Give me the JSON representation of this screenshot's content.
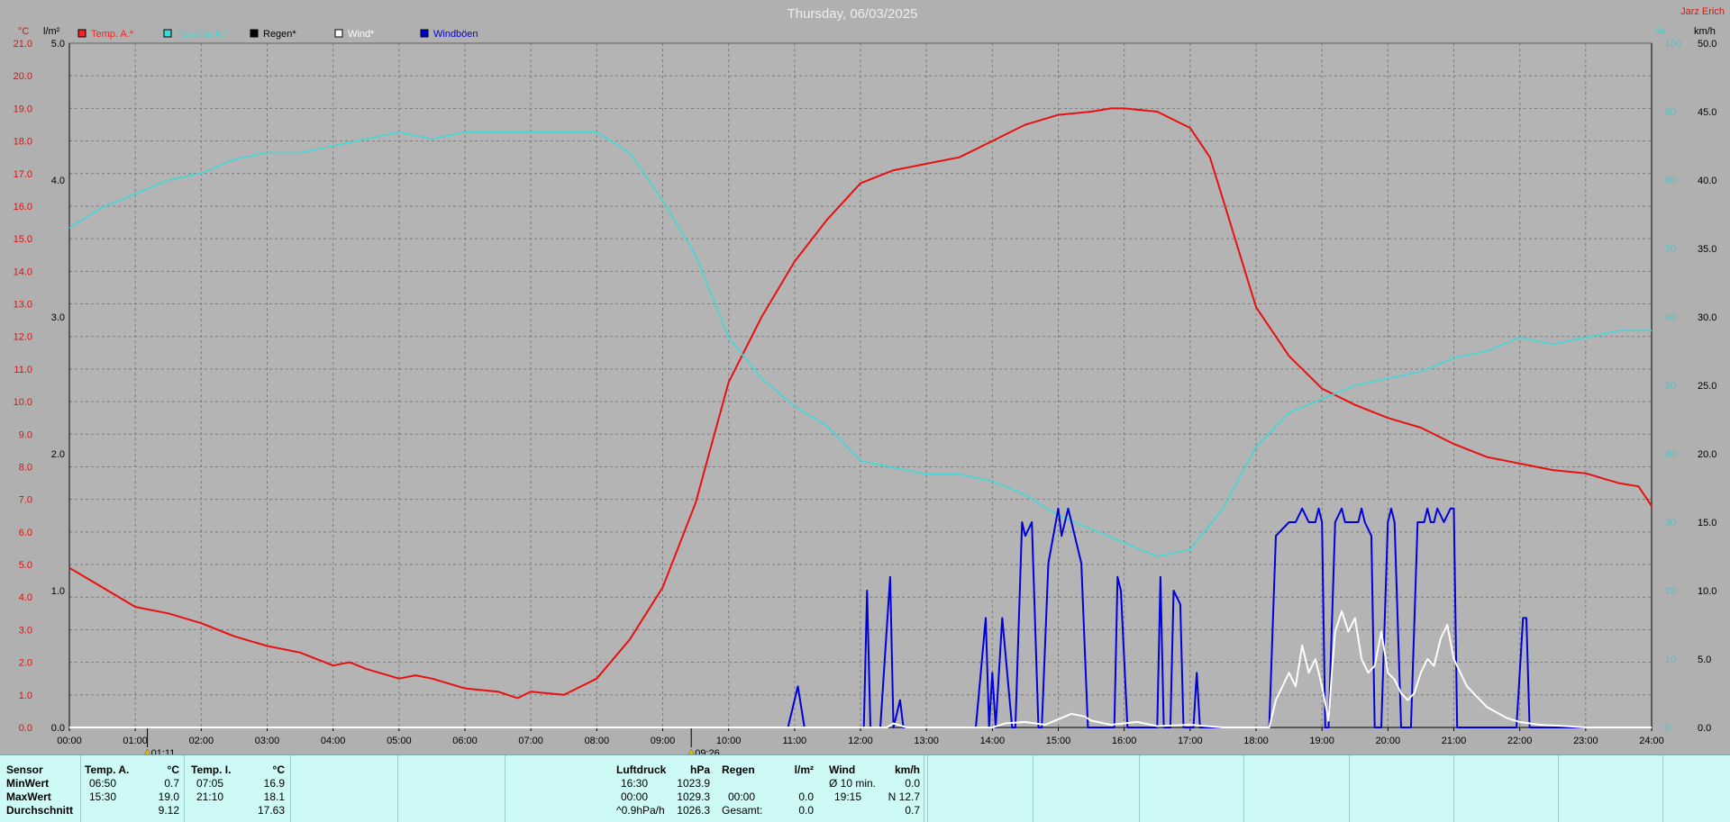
{
  "chart_data": {
    "type": "line",
    "title": "Thursday, 06/03/2025",
    "top_right_label": "Jarz Erich",
    "x_ticks": [
      "00:00",
      "01:00",
      "02:00",
      "03:00",
      "04:00",
      "05:00",
      "06:00",
      "07:00",
      "08:00",
      "09:00",
      "10:00",
      "11:00",
      "12:00",
      "13:00",
      "14:00",
      "15:00",
      "16:00",
      "17:00",
      "18:00",
      "19:00",
      "20:00",
      "21:00",
      "22:00",
      "23:00",
      "24:00"
    ],
    "x_range_hours": [
      0,
      24
    ],
    "y_left_temp": {
      "unit": "°C",
      "range": [
        0,
        21
      ],
      "ticks": [
        "0.0",
        "1.0",
        "2.0",
        "3.0",
        "4.0",
        "5.0",
        "6.0",
        "7.0",
        "8.0",
        "9.0",
        "10.0",
        "11.0",
        "12.0",
        "13.0",
        "14.0",
        "15.0",
        "16.0",
        "17.0",
        "18.0",
        "19.0",
        "20.0",
        "21.0"
      ]
    },
    "y_left_rain": {
      "unit": "l/m²",
      "range": [
        0,
        5
      ],
      "ticks": [
        "0.0",
        "1.0",
        "2.0",
        "3.0",
        "4.0",
        "5.0"
      ]
    },
    "y_right_humidity": {
      "unit": "%",
      "range": [
        0,
        100
      ],
      "ticks": [
        "0",
        "10",
        "20",
        "30",
        "40",
        "50",
        "60",
        "70",
        "80",
        "90",
        "100"
      ]
    },
    "y_right_wind": {
      "unit": "km/h",
      "range": [
        0,
        50
      ],
      "ticks": [
        "0.0",
        "5.0",
        "10.0",
        "15.0",
        "20.0",
        "25.0",
        "30.0",
        "35.0",
        "40.0",
        "45.0",
        "50.0"
      ]
    },
    "legend": [
      {
        "label": "Temp. A.*",
        "color": "#ff2020"
      },
      {
        "label": "Feuchte A.*",
        "color": "#40d8d8"
      },
      {
        "label": "Regen*",
        "color": "#000000"
      },
      {
        "label": "Wind*",
        "color": "#ffffff"
      },
      {
        "label": "Windböen",
        "color": "#0000dd"
      }
    ],
    "markers": [
      "01:11",
      "09:26"
    ],
    "grid": true,
    "series": [
      {
        "name": "Temp. A.*",
        "axis": "temp",
        "color": "#e81010",
        "x": [
          0,
          0.25,
          0.5,
          1,
          1.5,
          2,
          2.5,
          3,
          3.5,
          4,
          4.25,
          4.5,
          5,
          5.25,
          5.5,
          6,
          6.5,
          6.8,
          7,
          7.5,
          8,
          8.5,
          9,
          9.5,
          10,
          10.5,
          11,
          11.5,
          12,
          12.5,
          13,
          13.5,
          14,
          14.5,
          15,
          15.5,
          15.8,
          16,
          16.5,
          17,
          17.3,
          17.5,
          18,
          18.5,
          19,
          19.5,
          20,
          20.5,
          21,
          21.5,
          22,
          22.5,
          23,
          23.5,
          23.8,
          24
        ],
        "y": [
          4.9,
          4.6,
          4.3,
          3.7,
          3.5,
          3.2,
          2.8,
          2.5,
          2.3,
          1.9,
          2.0,
          1.8,
          1.5,
          1.6,
          1.5,
          1.2,
          1.1,
          0.9,
          1.1,
          1.0,
          1.5,
          2.7,
          4.3,
          6.9,
          10.6,
          12.6,
          14.3,
          15.6,
          16.7,
          17.1,
          17.3,
          17.5,
          18.0,
          18.5,
          18.8,
          18.9,
          19.0,
          19.0,
          18.9,
          18.4,
          17.5,
          16.2,
          12.9,
          11.4,
          10.4,
          9.9,
          9.5,
          9.2,
          8.7,
          8.3,
          8.1,
          7.9,
          7.8,
          7.5,
          7.4,
          6.8
        ]
      },
      {
        "name": "Feuchte A.*",
        "axis": "humidity",
        "color": "#40d8d8",
        "x": [
          0,
          0.5,
          1,
          1.5,
          2,
          2.5,
          3,
          3.5,
          4,
          4.5,
          5,
          5.5,
          6,
          6.5,
          7,
          7.5,
          8,
          8.5,
          9,
          9.5,
          10,
          10.5,
          11,
          11.5,
          12,
          12.5,
          13,
          13.5,
          14,
          14.5,
          15,
          15.5,
          16,
          16.5,
          17,
          17.5,
          18,
          18.5,
          19,
          19.5,
          20,
          20.5,
          21,
          21.5,
          22,
          22.5,
          23,
          23.5,
          24
        ],
        "y": [
          73,
          76,
          78,
          80,
          81,
          83,
          84,
          84,
          85,
          86,
          87,
          86,
          87,
          87,
          87,
          87,
          87,
          84,
          77,
          69,
          57,
          51,
          47,
          44,
          39,
          38,
          37,
          37,
          36,
          34,
          31,
          29,
          27,
          25,
          26,
          32,
          41,
          46,
          48,
          50,
          51,
          52,
          54,
          55,
          57,
          56,
          57,
          58,
          58
        ]
      },
      {
        "name": "Windböen",
        "axis": "wind",
        "color": "#0000dd",
        "x": [
          0,
          10.9,
          11.05,
          11.15,
          11.3,
          12,
          12.05,
          12.1,
          12.15,
          12.3,
          12.45,
          12.5,
          12.6,
          12.65,
          13.75,
          13.9,
          13.95,
          14.0,
          14.05,
          14.15,
          14.3,
          14.35,
          14.45,
          14.5,
          14.6,
          14.7,
          14.75,
          14.85,
          15.0,
          15.05,
          15.15,
          15.25,
          15.35,
          15.45,
          15.5,
          15.55,
          15.6,
          15.85,
          15.9,
          15.95,
          16.05,
          16.15,
          16.2,
          16.25,
          16.5,
          16.55,
          16.6,
          16.65,
          16.7,
          16.75,
          16.85,
          16.9,
          16.95,
          17.05,
          17.1,
          17.15,
          18.2,
          18.3,
          18.5,
          18.6,
          18.7,
          18.8,
          18.9,
          18.95,
          19.0,
          19.05,
          19.1,
          19.2,
          19.3,
          19.35,
          19.45,
          19.55,
          19.6,
          19.65,
          19.75,
          19.8,
          19.85,
          19.9,
          20.0,
          20.05,
          20.1,
          20.2,
          20.25,
          20.35,
          20.45,
          20.5,
          20.55,
          20.6,
          20.65,
          20.7,
          20.75,
          20.85,
          20.95,
          21.0,
          21.05,
          21.1,
          21.15,
          21.25,
          21.3,
          21.95,
          22.05,
          22.1,
          22.15,
          22.25,
          24
        ],
        "y": [
          0,
          0,
          3,
          0,
          0,
          0,
          0,
          10,
          0,
          0,
          11,
          0,
          2,
          0,
          0,
          8,
          0,
          4,
          0,
          8,
          0,
          0,
          15,
          14,
          15,
          0,
          0,
          12,
          16,
          14,
          16,
          14,
          12,
          0,
          0,
          0,
          0,
          0,
          11,
          10,
          0,
          0,
          0,
          0,
          0,
          11,
          0,
          0,
          0,
          10,
          9,
          0,
          0,
          0,
          4,
          0,
          0,
          14,
          15,
          15,
          16,
          15,
          15,
          16,
          15,
          0,
          0,
          15,
          16,
          15,
          15,
          15,
          16,
          15,
          14,
          0,
          0,
          0,
          15,
          16,
          15,
          0,
          0,
          0,
          15,
          15,
          15,
          16,
          15,
          15,
          16,
          15,
          16,
          16,
          0,
          0,
          0,
          0,
          0,
          0,
          8,
          8,
          0,
          0,
          0
        ]
      },
      {
        "name": "Wind*",
        "axis": "wind",
        "color": "#ffffff",
        "x": [
          0,
          12.4,
          12.5,
          12.7,
          14.0,
          14.2,
          14.5,
          14.8,
          15.0,
          15.2,
          15.4,
          15.5,
          15.8,
          16.2,
          16.5,
          17.0,
          17.5,
          18.2,
          18.3,
          18.5,
          18.6,
          18.7,
          18.8,
          18.9,
          19.0,
          19.1,
          19.15,
          19.2,
          19.3,
          19.4,
          19.5,
          19.6,
          19.7,
          19.8,
          19.9,
          20.0,
          20.1,
          20.2,
          20.3,
          20.4,
          20.5,
          20.6,
          20.7,
          20.8,
          20.9,
          21.0,
          21.2,
          21.5,
          21.8,
          22.0,
          22.3,
          22.7,
          23.0,
          24
        ],
        "y": [
          0,
          0,
          0.3,
          0,
          0,
          0.3,
          0.4,
          0.2,
          0.6,
          1.0,
          0.8,
          0.5,
          0.2,
          0.4,
          0.1,
          0.2,
          0,
          0,
          2.0,
          4.0,
          3.0,
          6.0,
          4.0,
          5.0,
          3.0,
          0.5,
          4.0,
          7.0,
          8.5,
          7.0,
          8.0,
          5.0,
          4.0,
          4.5,
          7.0,
          4.0,
          3.5,
          2.5,
          2.0,
          2.5,
          4.0,
          5.0,
          4.5,
          6.5,
          7.5,
          5.0,
          3.0,
          1.5,
          0.7,
          0.4,
          0.2,
          0.1,
          0,
          0
        ]
      }
    ]
  },
  "stats": {
    "columns": [
      {
        "header": "Sensor",
        "rows": [
          "MinWert",
          "MaxWert",
          "Durchschnitt"
        ]
      },
      {
        "header": "Temp. A.",
        "unit": "°C",
        "rows": [
          [
            "06:50",
            "0.7"
          ],
          [
            "15:30",
            "19.0"
          ],
          [
            "",
            "9.12"
          ]
        ]
      },
      {
        "header": "Temp. I.",
        "unit": "°C",
        "rows": [
          [
            "07:05",
            "16.9"
          ],
          [
            "21:10",
            "18.1"
          ],
          [
            "",
            "17.63"
          ]
        ]
      },
      {
        "header": "Luftdruck",
        "unit": "hPa",
        "rows": [
          [
            "16:30",
            "1023.9"
          ],
          [
            "00:00",
            "1029.3"
          ],
          [
            "^0.9hPa/h",
            "1026.3"
          ]
        ]
      },
      {
        "header": "Regen",
        "unit": "l/m²",
        "rows": [
          [
            "",
            ""
          ],
          [
            "00:00",
            "0.0"
          ],
          [
            "Gesamt:",
            "0.0"
          ]
        ]
      },
      {
        "header": "Wind",
        "unit": "km/h",
        "rows": [
          [
            "Ø 10 min.",
            "0.0"
          ],
          [
            "19:15",
            "N 12.7"
          ],
          [
            "",
            "0.7"
          ]
        ]
      }
    ]
  }
}
